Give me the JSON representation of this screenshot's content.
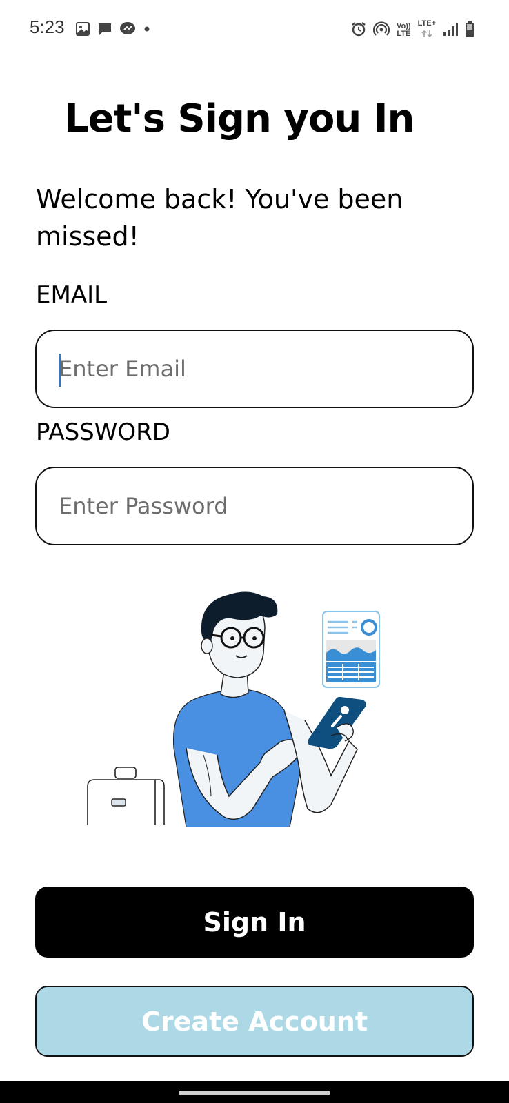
{
  "status_bar": {
    "time": "5:23",
    "left_icons": [
      "gallery-icon",
      "chat-bubble-icon",
      "messenger-icon",
      "dot-icon"
    ],
    "right_icons": [
      "alarm-icon",
      "hotspot-icon",
      "volte-icon",
      "lte-plus-icon",
      "signal-icon",
      "battery-icon"
    ],
    "volte_top": "Vo))",
    "volte_bottom": "LTE",
    "lte_plus": "LTE+"
  },
  "page": {
    "title": "Let's Sign you In",
    "subtitle": "Welcome back! You've been missed!"
  },
  "form": {
    "email_label": "EMAIL",
    "email_placeholder": "Enter Email",
    "email_value": "",
    "password_label": "PASSWORD",
    "password_placeholder": "Enter Password",
    "password_value": ""
  },
  "illustration": {
    "name": "man-with-phone-illustration"
  },
  "actions": {
    "sign_in_label": "Sign In",
    "create_account_label": "Create Account"
  },
  "colors": {
    "primary_button": "#000000",
    "secondary_button": "#add8e6",
    "illustration_blue": "#4a90e2",
    "caret": "#2d78c4"
  }
}
